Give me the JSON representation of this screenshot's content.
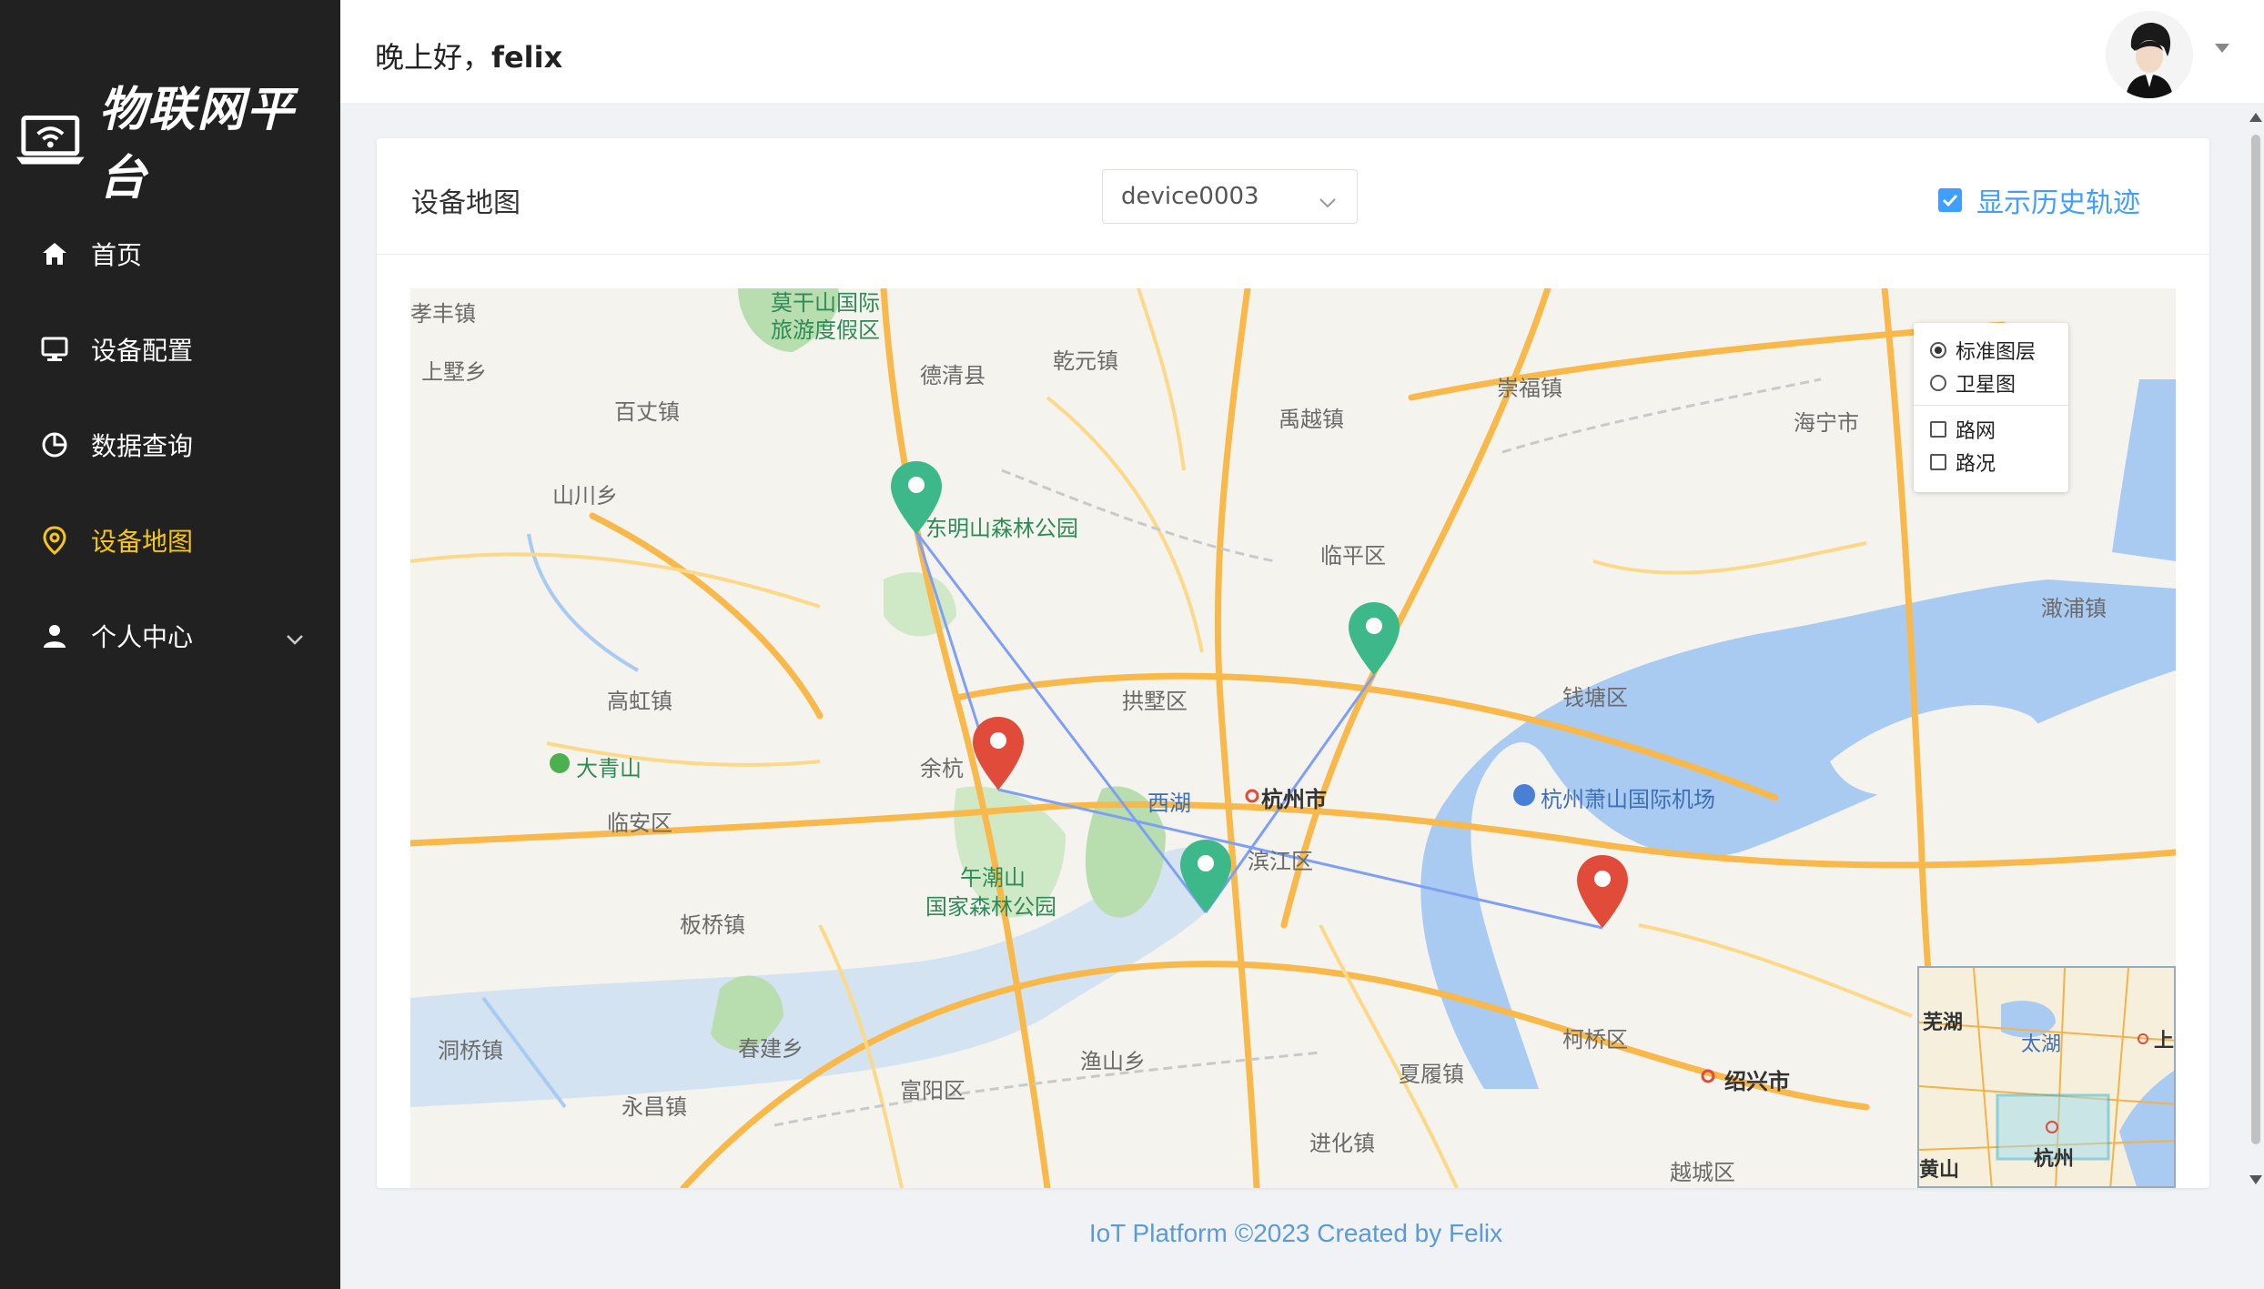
{
  "app": {
    "title": "物联网平台"
  },
  "sidebar": {
    "items": [
      {
        "label": "首页",
        "icon": "home-icon",
        "active": false
      },
      {
        "label": "设备配置",
        "icon": "monitor-icon",
        "active": false
      },
      {
        "label": "数据查询",
        "icon": "pie-chart-icon",
        "active": false
      },
      {
        "label": "设备地图",
        "icon": "location-pin-icon",
        "active": true
      },
      {
        "label": "个人中心",
        "icon": "user-icon",
        "active": false,
        "expandable": true
      }
    ],
    "active_color": "#f5c518"
  },
  "header": {
    "greeting": "晚上好，",
    "username": "felix"
  },
  "card": {
    "title": "设备地图",
    "device_select": {
      "value": "device0003"
    },
    "history_checkbox": {
      "label": "显示历史轨迹",
      "checked": true
    }
  },
  "map": {
    "layer_options": {
      "standard": "标准图层",
      "satellite": "卫星图",
      "road_net": "路网",
      "traffic": "路况"
    },
    "selected_layer": "标准图层",
    "labels": {
      "xiaofeng": "孝丰镇",
      "moganshan": "莫干山国际",
      "moganshan2": "旅游度假区",
      "deqing": "德清县",
      "qianyuan": "乾元镇",
      "shangshu": "上墅乡",
      "baizhang": "百丈镇",
      "yuyue": "禹越镇",
      "chongfu": "崇福镇",
      "haining": "海宁市",
      "shanchuan": "山川乡",
      "dongmingshan": "东明山森林公园",
      "linping": "临平区",
      "ganpu": "澉浦镇",
      "gaohong": "高虹镇",
      "gongshu": "拱墅区",
      "qiantang": "钱塘区",
      "daqingshan": "大青山",
      "yuhang": "余杭",
      "xihu": "西湖",
      "hangzhou": "杭州市",
      "airport": "杭州萧山国际机场",
      "linan": "临安区",
      "wuchaoshan": "午潮山",
      "wuchaoshan2": "国家森林公园",
      "banqiao": "板桥镇",
      "binjiang": "滨江区",
      "dongqiao": "洞桥镇",
      "chunjian": "春建乡",
      "yuchang": "永昌镇",
      "fuyang": "富阳区",
      "yushan": "渔山乡",
      "xiafeng": "夏履镇",
      "keqiao": "柯桥区",
      "shaoxing": "绍兴市",
      "jinhua": "进化镇",
      "yuecheng": "越城区"
    },
    "overview_labels": {
      "wuhu": "芜湖",
      "taihu": "太湖",
      "hangzhou": "杭州",
      "huangshan": "黄山",
      "shang": "上"
    },
    "markers": [
      {
        "color": "green",
        "name": "marker-green-north"
      },
      {
        "color": "green",
        "name": "marker-green-east"
      },
      {
        "color": "red",
        "name": "marker-red-west"
      },
      {
        "color": "green",
        "name": "marker-green-south"
      },
      {
        "color": "red",
        "name": "marker-red-southeast"
      }
    ],
    "colors": {
      "green": "#3cb88a",
      "red": "#e04b3a",
      "track": "#7f9ff5"
    }
  },
  "footer": {
    "text": "IoT Platform ©2023 Created by Felix"
  }
}
